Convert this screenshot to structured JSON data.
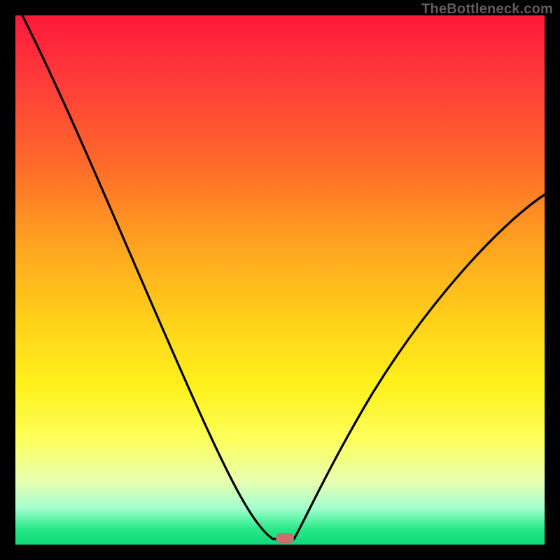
{
  "watermark": "TheBottleneck.com",
  "marker": {
    "x_frac": 0.508,
    "y_frac": 0.992
  },
  "chart_data": {
    "type": "line",
    "title": "",
    "xlabel": "",
    "ylabel": "",
    "xlim": [
      0,
      100
    ],
    "ylim": [
      0,
      100
    ],
    "series": [
      {
        "name": "bottleneck-curve",
        "x": [
          0,
          5,
          10,
          15,
          20,
          25,
          30,
          35,
          40,
          45,
          48,
          50,
          52,
          55,
          60,
          65,
          70,
          75,
          80,
          85,
          90,
          95,
          100
        ],
        "y": [
          100,
          92,
          83,
          74,
          65,
          56,
          47,
          37,
          27,
          14,
          3,
          1,
          1,
          6,
          14,
          22,
          30,
          37,
          44,
          50,
          56,
          61,
          66
        ]
      }
    ],
    "annotations": [
      {
        "name": "optimum-marker",
        "x": 50.8,
        "y": 0.8
      }
    ],
    "background": "red-yellow-green-vertical-gradient"
  }
}
